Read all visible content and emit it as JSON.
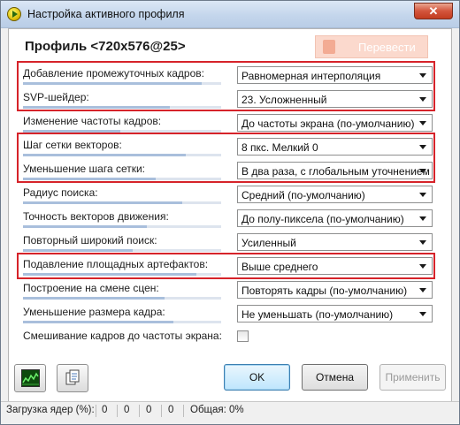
{
  "window": {
    "title": "Настройка активного профиля",
    "close_label": "✕"
  },
  "header": {
    "profile_title": "Профиль <720x576@25>",
    "translate_label": "Перевести"
  },
  "rows": [
    {
      "label": "Добавление промежуточных кадров:",
      "value": "Равномерная интерполяция"
    },
    {
      "label": "SVP-шейдер:",
      "value": "23. Усложненный"
    },
    {
      "label": "Изменение частоты кадров:",
      "value": "До частоты экрана (по-умолчанию)"
    },
    {
      "label": "Шаг сетки векторов:",
      "value": "8 пкс. Мелкий 0"
    },
    {
      "label": "Уменьшение шага сетки:",
      "value": "В два раза, с глобальным уточнением"
    },
    {
      "label": "Радиус поиска:",
      "value": "Средний (по-умолчанию)"
    },
    {
      "label": "Точность векторов движения:",
      "value": "До полу-пиксела (по-умолчанию)"
    },
    {
      "label": "Повторный широкий поиск:",
      "value": "Усиленный"
    },
    {
      "label": "Подавление площадных артефактов:",
      "value": "Выше среднего"
    },
    {
      "label": "Построение на смене сцен:",
      "value": "Повторять кадры (по-умолчанию)"
    },
    {
      "label": "Уменьшение размера кадра:",
      "value": "Не уменьшать (по-умолчанию)"
    }
  ],
  "checkbox_row": {
    "label": "Смешивание кадров до частоты экрана:",
    "checked": false
  },
  "buttons": {
    "ok": "OK",
    "cancel": "Отмена",
    "apply": "Применить"
  },
  "statusbar": {
    "cores_label": "Загрузка ядер (%):",
    "cores": [
      "0",
      "0",
      "0",
      "0"
    ],
    "total": "Общая: 0%"
  },
  "colors": {
    "highlight": "#d6232a",
    "accent": "#a9bfdc",
    "translate_button": "#fbd9cd"
  }
}
